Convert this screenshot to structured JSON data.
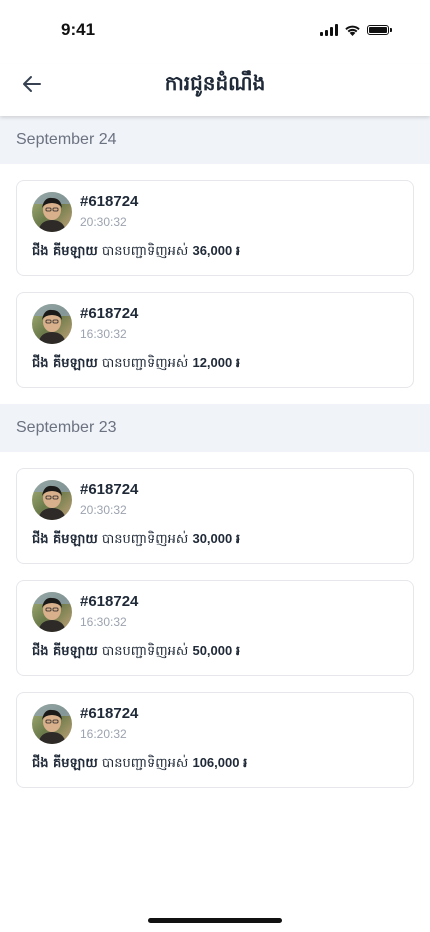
{
  "status_bar": {
    "time": "9:41"
  },
  "header": {
    "title": "ការជូនដំណឹង"
  },
  "groups": [
    {
      "date": "September 24",
      "items": [
        {
          "id": "#618724",
          "time": "20:30:32",
          "name": "ជីង គីមឡាយ",
          "action": "បានបញ្ជាទិញអស់",
          "amount": "36,000 ៛"
        },
        {
          "id": "#618724",
          "time": "16:30:32",
          "name": "ជីង គីមឡាយ",
          "action": "បានបញ្ជាទិញអស់",
          "amount": "12,000 ៛"
        }
      ]
    },
    {
      "date": "September 23",
      "items": [
        {
          "id": "#618724",
          "time": "20:30:32",
          "name": "ជីង គីមឡាយ",
          "action": "បានបញ្ជាទិញអស់",
          "amount": "30,000 ៛"
        },
        {
          "id": "#618724",
          "time": "16:30:32",
          "name": "ជីង គីមឡាយ",
          "action": "បានបញ្ជាទិញអស់",
          "amount": "50,000 ៛"
        },
        {
          "id": "#618724",
          "time": "16:20:32",
          "name": "ជីង គីមឡាយ",
          "action": "បានបញ្ជាទិញអស់",
          "amount": "106,000 ៛"
        }
      ]
    }
  ]
}
